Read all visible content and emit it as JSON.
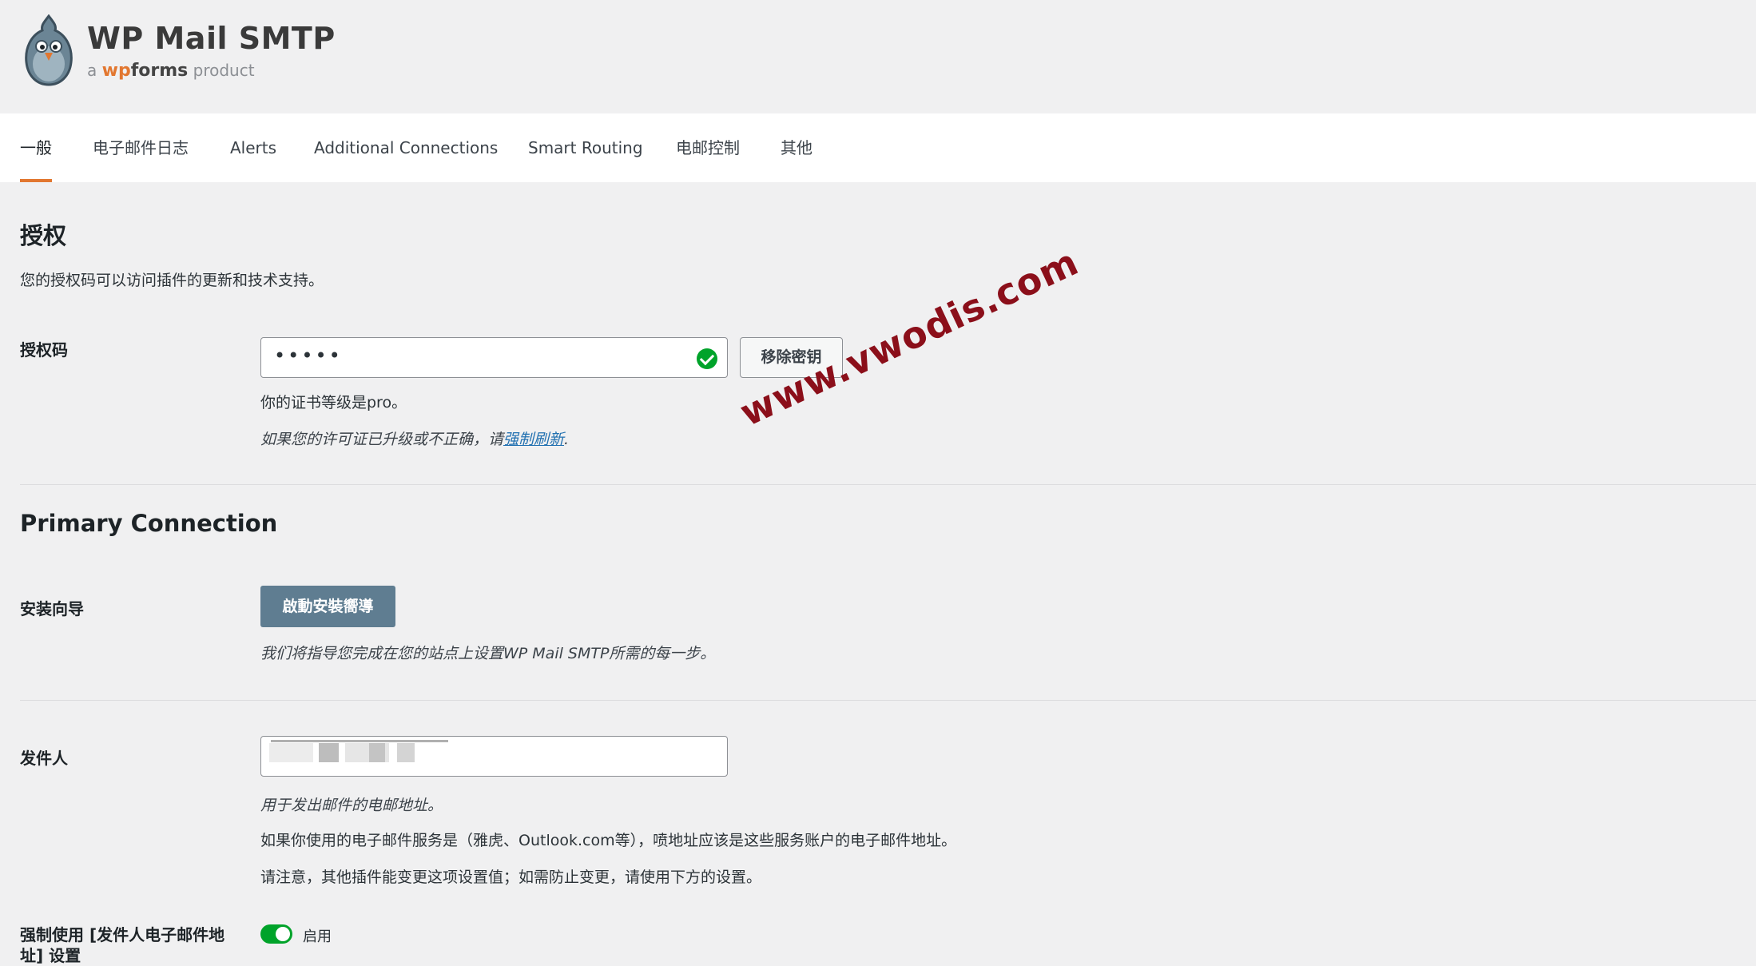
{
  "header": {
    "title": "WP Mail SMTP",
    "sub_a": "a",
    "sub_wp": "wp",
    "sub_forms": "forms",
    "sub_product": "product"
  },
  "tabs": [
    {
      "label": "一般",
      "active": true
    },
    {
      "label": "电子邮件日志"
    },
    {
      "label": "Alerts"
    },
    {
      "label": "Additional Connections"
    },
    {
      "label": "Smart Routing"
    },
    {
      "label": "电邮控制"
    },
    {
      "label": "其他"
    }
  ],
  "license": {
    "heading": "授权",
    "description": "您的授权码可以访问插件的更新和技术支持。",
    "label": "授权码",
    "key_value": "•••••",
    "remove_button": "移除密钥",
    "level_text": "你的证书等级是pro。",
    "refresh_prefix": "如果您的许可证已升级或不正确，请",
    "refresh_link": "强制刷新",
    "refresh_suffix": "."
  },
  "primary_connection": {
    "heading": "Primary Connection",
    "wizard_label": "安装向导",
    "wizard_button": "啟動安裝嚮導",
    "wizard_hint": "我们将指导您完成在您的站点上设置WP Mail SMTP所需的每一步。"
  },
  "from": {
    "label": "发件人",
    "hint1": "用于发出邮件的电邮地址。",
    "hint2": "如果你使用的电子邮件服务是（雅虎、Outlook.com等），喷地址应该是这些服务账户的电子邮件地址。",
    "hint3": "请注意，其他插件能变更这项设置值；如需防止变更，请使用下方的设置。"
  },
  "force_from": {
    "label": "强制使用 [发件人电子邮件地",
    "label2": "址] 设置",
    "toggle_label": "启用",
    "enabled": true
  },
  "watermark": "www.vwodis.com",
  "colors": {
    "accent": "#e27730",
    "primary_button": "#5f7d91",
    "success": "#00a32a",
    "link": "#2271b1"
  }
}
